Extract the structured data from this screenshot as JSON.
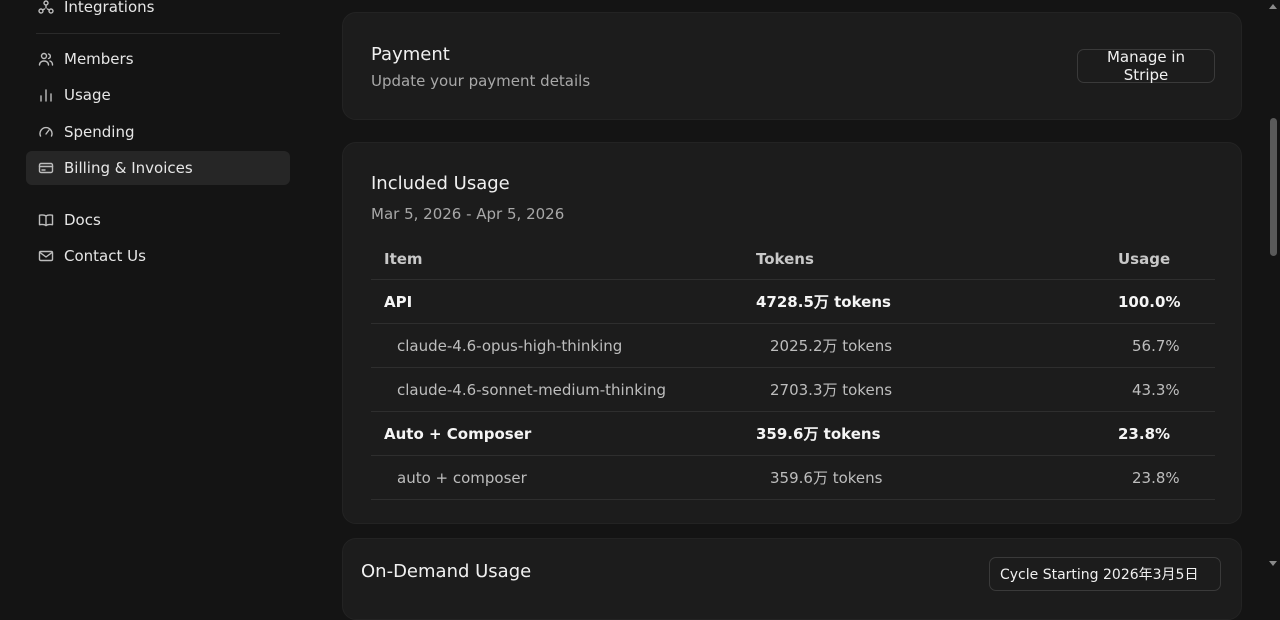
{
  "sidebar": {
    "items": [
      {
        "label": "Integrations",
        "icon": "integrations-icon"
      },
      {
        "label": "Members",
        "icon": "members-icon"
      },
      {
        "label": "Usage",
        "icon": "usage-icon"
      },
      {
        "label": "Spending",
        "icon": "spending-icon"
      },
      {
        "label": "Billing & Invoices",
        "icon": "billing-icon",
        "active": true
      },
      {
        "label": "Docs",
        "icon": "docs-icon"
      },
      {
        "label": "Contact Us",
        "icon": "mail-icon"
      }
    ]
  },
  "payment": {
    "title": "Payment",
    "subtitle": "Update your payment details",
    "button": "Manage in Stripe"
  },
  "included_usage": {
    "title": "Included Usage",
    "date_range": "Mar 5, 2026 - Apr 5, 2026",
    "columns": {
      "item": "Item",
      "tokens": "Tokens",
      "usage": "Usage"
    },
    "rows": [
      {
        "item": "API",
        "tokens": "4728.5万 tokens",
        "usage": "100.0%"
      },
      {
        "item": "claude-4.6-opus-high-thinking",
        "tokens": "2025.2万 tokens",
        "usage": "56.7%"
      },
      {
        "item": "claude-4.6-sonnet-medium-thinking",
        "tokens": "2703.3万 tokens",
        "usage": "43.3%"
      },
      {
        "item": "Auto + Composer",
        "tokens": "359.6万 tokens",
        "usage": "23.8%"
      },
      {
        "item": "auto + composer",
        "tokens": "359.6万 tokens",
        "usage": "23.8%"
      }
    ]
  },
  "on_demand": {
    "title": "On-Demand Usage",
    "cycle_select": "Cycle Starting 2026年3月5日"
  },
  "colors": {
    "background": "#141414",
    "card": "#1c1c1c",
    "active_nav": "#262626"
  }
}
